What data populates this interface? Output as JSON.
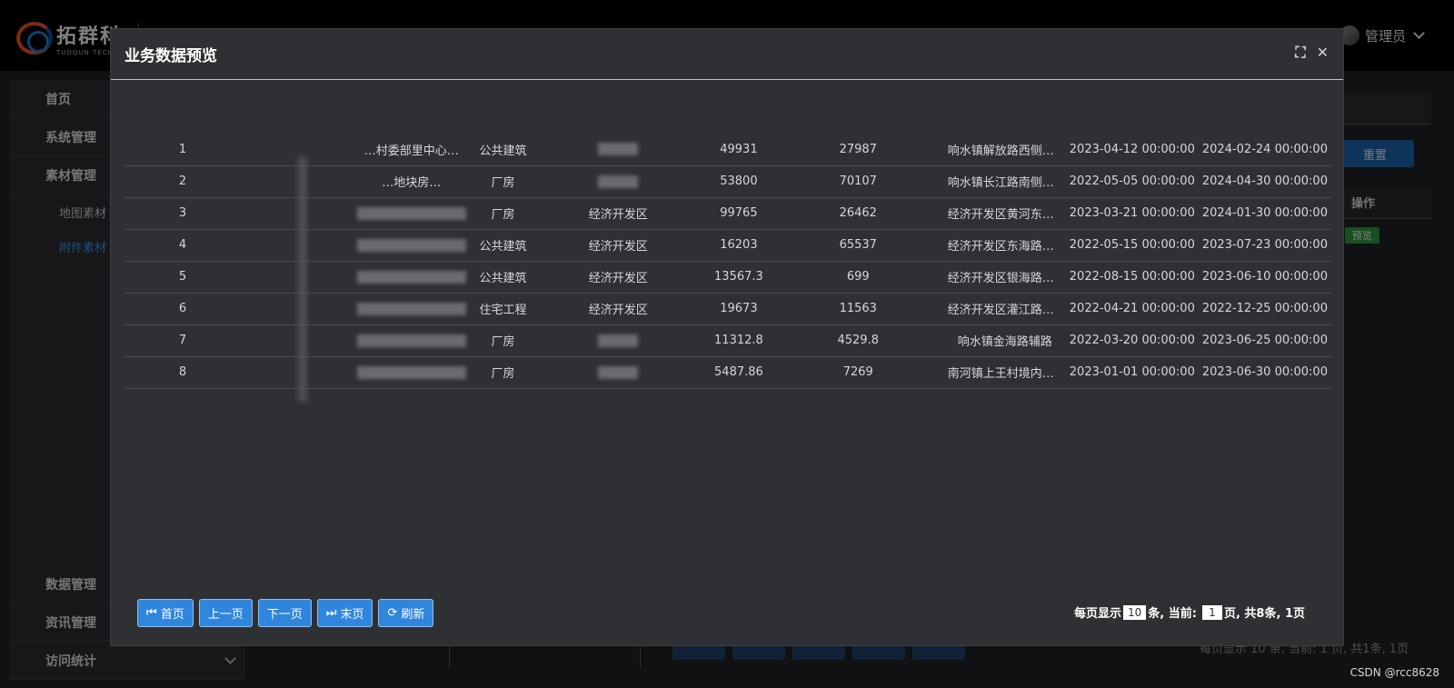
{
  "app": {
    "logo_cn": "拓群科",
    "logo_en": "TUOQUN TECH",
    "user_name": "管理员"
  },
  "sidebar": {
    "items": [
      {
        "label": "首页"
      },
      {
        "label": "系统管理"
      },
      {
        "label": "素材管理"
      }
    ],
    "sub_items": [
      {
        "label": "地图素材",
        "active": false
      },
      {
        "label": "附件素材",
        "active": true
      }
    ],
    "bottom_items": [
      {
        "label": "数据管理"
      },
      {
        "label": "资讯管理"
      },
      {
        "label": "访问统计"
      }
    ]
  },
  "background": {
    "reset_label": "重置",
    "op_header": "操作",
    "preview_label": "预览",
    "pager_text": "每页显示 10 条, 当前: 1 页, 共1条, 1页",
    "watermark": "CSDN @rcc8628"
  },
  "modal": {
    "title": "业务数据预览",
    "rows": [
      {
        "idx": "1",
        "name": "…村委部里中心…",
        "type": "公共建筑",
        "district": "",
        "v1": "49931",
        "v2": "27987",
        "addr": "响水镇解放路西侧、…",
        "start": "2023-04-12 00:00:00",
        "end": "2024-02-24 00:00:00"
      },
      {
        "idx": "2",
        "name": "…地块房…",
        "type": "厂房",
        "district": "",
        "v1": "53800",
        "v2": "70107",
        "addr": "响水镇长江路南侧、…",
        "start": "2022-05-05 00:00:00",
        "end": "2024-04-30 00:00:00"
      },
      {
        "idx": "3",
        "name": "",
        "type": "厂房",
        "district": "经济开发区",
        "v1": "99765",
        "v2": "26462",
        "addr": "经济开发区黄河东路…",
        "start": "2023-03-21 00:00:00",
        "end": "2024-01-30 00:00:00"
      },
      {
        "idx": "4",
        "name": "",
        "type": "公共建筑",
        "district": "经济开发区",
        "v1": "16203",
        "v2": "65537",
        "addr": "经济开发区东海路与…",
        "start": "2022-05-15 00:00:00",
        "end": "2023-07-23 00:00:00"
      },
      {
        "idx": "5",
        "name": "",
        "type": "公共建筑",
        "district": "经济开发区",
        "v1": "13567.3",
        "v2": "699",
        "addr": "经济开发区银海路东…",
        "start": "2022-08-15 00:00:00",
        "end": "2023-06-10 00:00:00"
      },
      {
        "idx": "6",
        "name": "",
        "type": "住宅工程",
        "district": "经济开发区",
        "v1": "19673",
        "v2": "11563",
        "addr": "经济开发区灌江路北…",
        "start": "2022-04-21 00:00:00",
        "end": "2022-12-25 00:00:00"
      },
      {
        "idx": "7",
        "name": "",
        "type": "厂房",
        "district": "",
        "v1": "11312.8",
        "v2": "4529.8",
        "addr": "响水镇金海路辅路",
        "start": "2022-03-20 00:00:00",
        "end": "2023-06-25 00:00:00"
      },
      {
        "idx": "8",
        "name": "",
        "type": "厂房",
        "district": "",
        "v1": "5487.86",
        "v2": "7269",
        "addr": "南河镇上王村境内，…",
        "start": "2023-01-01 00:00:00",
        "end": "2023-06-30 00:00:00"
      }
    ],
    "pager": {
      "first": "首页",
      "prev": "上一页",
      "next": "下一页",
      "last": "末页",
      "refresh": "刷新",
      "per_page_prefix": "每页显示",
      "per_page_value": "10",
      "per_page_suffix": "条, 当前:",
      "current_page": "1",
      "summary": "页, 共8条, 1页"
    }
  }
}
